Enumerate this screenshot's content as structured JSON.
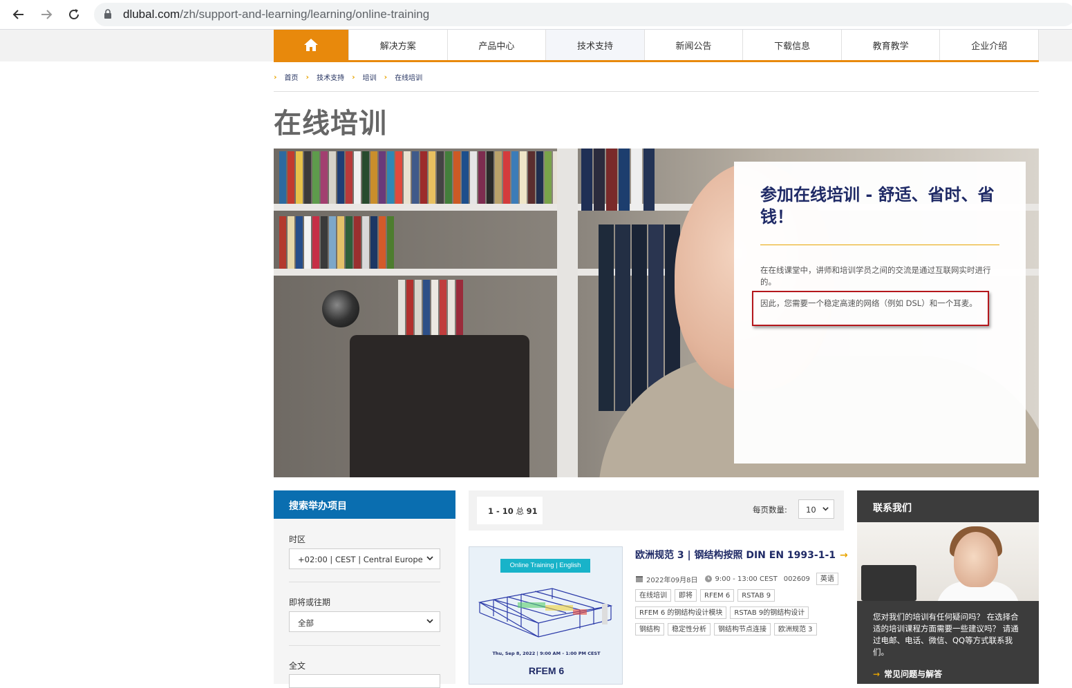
{
  "browser": {
    "url_host": "dlubal.com",
    "url_path": "/zh/support-and-learning/learning/online-training"
  },
  "menu": {
    "items": [
      "解决方案",
      "产品中心",
      "技术支持",
      "新闻公告",
      "下载信息",
      "教育教学",
      "企业介绍"
    ]
  },
  "breadcrumb": [
    "首页",
    "技术支持",
    "培训",
    "在线培训"
  ],
  "page_title": "在线培训",
  "hero": {
    "title": "参加在线培训 - 舒适、省时、省钱！",
    "paragraph1": "在在线课堂中，讲师和培训学员之间的交流是通过互联网实时进行的。",
    "paragraph2": "因此，您需要一个稳定高速的网络（例如 DSL）和一个耳麦。"
  },
  "search": {
    "heading": "搜索举办项目",
    "timezone_label": "时区",
    "timezone_value": "+02:00 | CEST | Central Europe",
    "period_label": "即将或往期",
    "period_value": "全部",
    "fulltext_label": "全文"
  },
  "results": {
    "range": "1 - 10",
    "total_word": "总",
    "total": "91",
    "per_page_label": "每页数量:",
    "per_page_value": "10"
  },
  "event": {
    "thumb_tag": "Online Training | English",
    "thumb_date": "Thu, Sep 8, 2022 | 9:00 AM - 1:00 PM CEST",
    "thumb_product": "RFEM 6",
    "title": "欧洲规范 3 | 钢结构按照 DIN EN 1993-1-1",
    "date": "2022年09月8日",
    "time": "9:00 - 13:00 CEST",
    "code": "002609",
    "language": "英语",
    "tags_row1": [
      "在线培训",
      "即将",
      "RFEM 6",
      "RSTAB 9"
    ],
    "tags_row2": [
      "RFEM 6 的钢结构设计模块",
      "RSTAB 9的钢结构设计"
    ],
    "tags_row3": [
      "钢结构",
      "稳定性分析",
      "钢结构节点连接",
      "欧洲规范 3"
    ]
  },
  "contact": {
    "heading": "联系我们",
    "text": "您对我们的培训有任何疑问吗？ 在选择合适的培训课程方面需要一些建议吗？ 请通过电邮、电话、微信、QQ等方式联系我们。",
    "link": "常见问题与解答"
  },
  "colors": {
    "accent": "#e8890c",
    "navy": "#1f2a66",
    "search_blue": "#0a6eb0",
    "highlight_red": "#b4161b"
  }
}
